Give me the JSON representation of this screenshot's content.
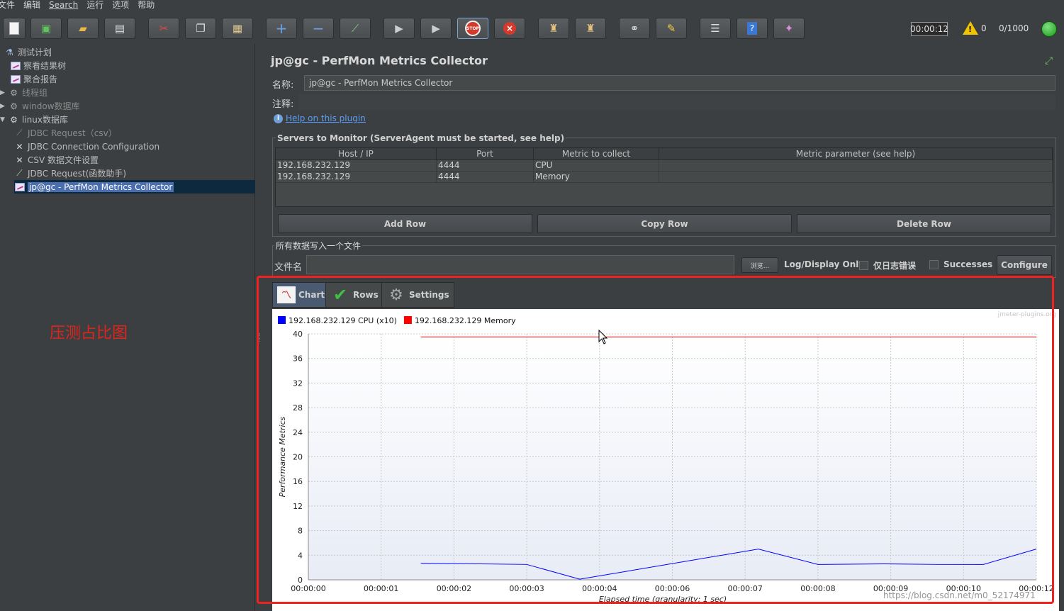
{
  "menu": [
    "文件",
    "编辑",
    "Search",
    "运行",
    "选项",
    "帮助"
  ],
  "toolbar": {
    "buttons": [
      "new",
      "templates",
      "open",
      "save",
      "cut",
      "copy",
      "paste",
      "expand",
      "collapse",
      "toggle",
      "start",
      "start-no-pauses",
      "stop",
      "shutdown",
      "clear",
      "clear-all",
      "search",
      "reset-search",
      "function-helper",
      "help",
      "remote"
    ],
    "stop_label": "STOP",
    "timer": "00:00:12",
    "warnings": "0",
    "threads": "0/1000"
  },
  "tree": {
    "items": [
      {
        "label": "测试计划",
        "icon": "test-plan-icon",
        "dim": false
      },
      {
        "label": "察看结果树",
        "icon": "graph-icon",
        "dim": false
      },
      {
        "label": "聚合报告",
        "icon": "graph-icon",
        "dim": false
      },
      {
        "label": "线程组",
        "icon": "gear-icon",
        "dim": true
      },
      {
        "label": "window数据库",
        "icon": "gear-icon",
        "dim": true
      },
      {
        "label": "linux数据库",
        "icon": "gear-icon",
        "dim": false
      },
      {
        "label": "JDBC Request（csv）",
        "icon": "pipette-icon",
        "dim": true
      },
      {
        "label": "JDBC Connection Configuration",
        "icon": "wrench-icon",
        "dim": false
      },
      {
        "label": "CSV 数据文件设置",
        "icon": "wrench-icon",
        "dim": false
      },
      {
        "label": "JDBC Request(函数助手)",
        "icon": "pipette-icon",
        "dim": false
      },
      {
        "label": "jp@gc - PerfMon Metrics Collector",
        "icon": "graph-icon",
        "dim": false,
        "selected": true
      }
    ],
    "annotation": "压测占比图"
  },
  "panel": {
    "title": "jp@gc - PerfMon Metrics Collector",
    "name_label": "名称:",
    "name_value": "jp@gc - PerfMon Metrics Collector",
    "comment_label": "注释:",
    "comment_value": "",
    "help_link": "Help on this plugin",
    "servers": {
      "legend": "Servers to Monitor (ServerAgent must be started, see help)",
      "columns": [
        "Host / IP",
        "Port",
        "Metric to collect",
        "Metric parameter (see help)"
      ],
      "rows": [
        [
          "192.168.232.129",
          "4444",
          "CPU",
          ""
        ],
        [
          "192.168.232.129",
          "4444",
          "Memory",
          ""
        ]
      ],
      "add_row": "Add Row",
      "copy_row": "Copy Row",
      "delete_row": "Delete Row"
    },
    "file": {
      "legend": "所有数据写入一个文件",
      "filename_label": "文件名",
      "filename_value": "",
      "browse": "浏览...",
      "log_display_only": "Log/Display Only:",
      "errors_only": "仅日志错误",
      "successes": "Successes",
      "configure": "Configure"
    },
    "tabs": [
      "Chart",
      "Rows",
      "Settings"
    ]
  },
  "colors": {
    "cpu": "#0000ff",
    "memory": "#ff0000",
    "highlight": "#f02121"
  },
  "chart_data": {
    "type": "line",
    "watermark_label": "jmeter-plugins.org",
    "xlabel": "Elapsed time (granularity: 1 sec)",
    "ylabel": "Performance Metrics",
    "ylim": [
      0,
      40
    ],
    "yticks": [
      0,
      4,
      8,
      12,
      16,
      20,
      24,
      28,
      32,
      36,
      40
    ],
    "xtick_labels": [
      "00:00:00",
      "00:00:01",
      "00:00:02",
      "00:00:03",
      "00:00:04",
      "00:00:06",
      "00:00:07",
      "00:00:08",
      "00:00:09",
      "00:00:10",
      "00:00:12"
    ],
    "legend_position": "top-left",
    "grid": true,
    "series": [
      {
        "name": "192.168.232.129 CPU (x10)",
        "x": [
          1.7,
          3.3,
          4.1,
          6.8,
          7.7,
          8.7,
          9.5,
          10.2,
          11.0
        ],
        "values": [
          2.7,
          2.5,
          0.1,
          5.0,
          2.5,
          2.6,
          2.5,
          2.5,
          5.0
        ]
      },
      {
        "name": "192.168.232.129 Memory",
        "x": [
          1.7,
          11.0
        ],
        "values": [
          39.5,
          39.5
        ]
      }
    ],
    "x_range": [
      0,
      11
    ]
  },
  "watermark": "https://blog.csdn.net/m0_52174971"
}
